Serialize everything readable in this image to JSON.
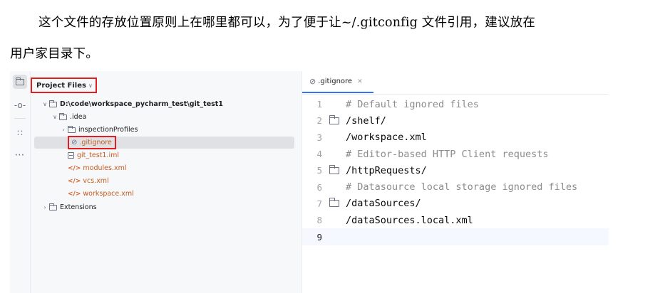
{
  "paragraphs": {
    "line1": "这个文件的存放位置原则上在哪里都可以，为了便于让~/.gitconfig 文件引用，建议放在",
    "line2": "用户家目录下。"
  },
  "toolwindow": {
    "icons": [
      "folder-icon",
      "commit-icon",
      "structure-icon",
      "more-icon"
    ]
  },
  "project_panel": {
    "title": "Project Files",
    "tree": [
      {
        "label": "D:\\code\\workspace_pycharm_test\\git_test1",
        "kind": "folder",
        "expanded": true,
        "bold": true
      },
      {
        "label": ".idea",
        "kind": "folder",
        "expanded": true
      },
      {
        "label": "inspectionProfiles",
        "kind": "folder",
        "expanded": false
      },
      {
        "label": ".gitignore",
        "kind": "gitignore",
        "selected": true
      },
      {
        "label": "git_test1.iml",
        "kind": "iml"
      },
      {
        "label": "modules.xml",
        "kind": "xml"
      },
      {
        "label": "vcs.xml",
        "kind": "xml"
      },
      {
        "label": "workspace.xml",
        "kind": "xml"
      },
      {
        "label": "Extensions",
        "kind": "folder",
        "expanded": false
      }
    ]
  },
  "editor": {
    "tab_label": ".gitignore",
    "lines": [
      {
        "num": "1",
        "text": "# Default ignored files",
        "comment": true,
        "fold": false
      },
      {
        "num": "2",
        "text": "/shelf/",
        "comment": false,
        "fold": true
      },
      {
        "num": "3",
        "text": "/workspace.xml",
        "comment": false,
        "fold": false
      },
      {
        "num": "4",
        "text": "# Editor-based HTTP Client requests",
        "comment": true,
        "fold": false
      },
      {
        "num": "5",
        "text": "/httpRequests/",
        "comment": false,
        "fold": true
      },
      {
        "num": "6",
        "text": "# Datasource local storage ignored files",
        "comment": true,
        "fold": false
      },
      {
        "num": "7",
        "text": "/dataSources/",
        "comment": false,
        "fold": true
      },
      {
        "num": "8",
        "text": "/dataSources.local.xml",
        "comment": false,
        "fold": false
      },
      {
        "num": "9",
        "text": "",
        "comment": false,
        "fold": false,
        "current": true
      }
    ]
  },
  "colors": {
    "highlight_box": "#e02020",
    "comment": "#8c8c8c",
    "accent": "#3574f0",
    "xml_icon": "#d9622b"
  }
}
